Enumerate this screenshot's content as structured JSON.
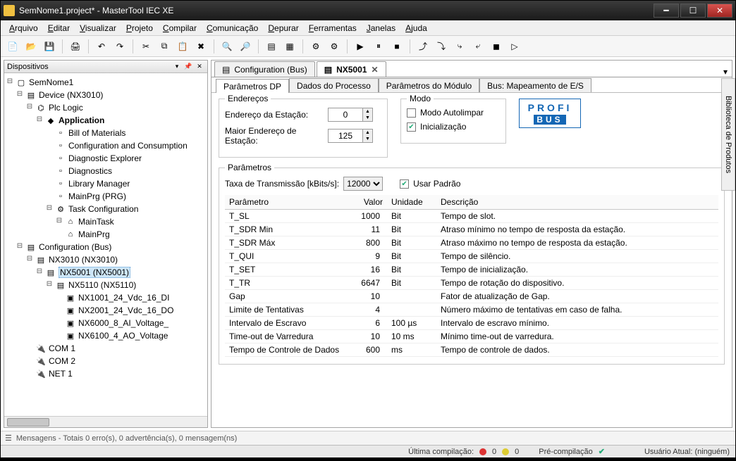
{
  "window": {
    "title": "SemNome1.project* - MasterTool IEC XE"
  },
  "menu": [
    "Arquivo",
    "Editar",
    "Visualizar",
    "Projeto",
    "Compilar",
    "Comunicação",
    "Depurar",
    "Ferramentas",
    "Janelas",
    "Ajuda"
  ],
  "toolbar_icons": [
    "new",
    "open",
    "save",
    "|",
    "print",
    "|",
    "undo",
    "redo",
    "|",
    "cut",
    "copy",
    "paste",
    "delete",
    "|",
    "find",
    "replace",
    "|",
    "props",
    "refs",
    "|",
    "gear",
    "gear2",
    "|",
    "play",
    "pause",
    "stop",
    "|",
    "step-over",
    "step-into",
    "step-out",
    "step-return",
    "stop2",
    "next"
  ],
  "devices_panel": {
    "title": "Dispositivos",
    "root": "SemNome1",
    "device": "Device (NX3010)",
    "plc": "Plc Logic",
    "app": "Application",
    "app_children": [
      "Bill of Materials",
      "Configuration and Consumption",
      "Diagnostic Explorer",
      "Diagnostics",
      "Library Manager",
      "MainPrg (PRG)",
      "Task Configuration"
    ],
    "task_children": [
      "MainTask",
      "MainPrg"
    ],
    "config_bus": "Configuration (Bus)",
    "nx3010": "NX3010 (NX3010)",
    "nx5001": "NX5001 (NX5001)",
    "nx5110": "NX5110 (NX5110)",
    "io_children": [
      "NX1001_24_Vdc_16_DI",
      "NX2001_24_Vdc_16_DO",
      "NX6000_8_AI_Voltage_",
      "NX6100_4_AO_Voltage"
    ],
    "coms": [
      "COM 1",
      "COM 2",
      "NET 1"
    ]
  },
  "doc_tabs": [
    {
      "label": "Configuration (Bus)",
      "active": false
    },
    {
      "label": "NX5001",
      "active": true
    }
  ],
  "inner_tabs": [
    "Parâmetros DP",
    "Dados do Processo",
    "Parâmetros do Módulo",
    "Bus: Mapeamento de E/S"
  ],
  "dp": {
    "group_enderecos": "Endereços",
    "lbl_endereco": "Endereço da Estação:",
    "val_endereco": "0",
    "lbl_maior": "Maior Endereço de Estação:",
    "val_maior": "125",
    "group_modo": "Modo",
    "chk_autolimpar": "Modo Autolimpar",
    "chk_init": "Inicialização",
    "group_param": "Parâmetros",
    "lbl_taxa": "Taxa de Transmissão [kBits/s]:",
    "val_taxa": "12000",
    "chk_padrao": "Usar Padrão",
    "logo_l1": "PROFI",
    "logo_l2": "BUS",
    "th_param": "Parâmetro",
    "th_valor": "Valor",
    "th_unidade": "Unidade",
    "th_desc": "Descrição",
    "rows": [
      {
        "p": "T_SL",
        "v": "1000",
        "u": "Bit",
        "d": "Tempo de slot."
      },
      {
        "p": "T_SDR Min",
        "v": "11",
        "u": "Bit",
        "d": "Atraso mínimo no tempo de resposta da estação."
      },
      {
        "p": "T_SDR Máx",
        "v": "800",
        "u": "Bit",
        "d": "Atraso máximo no tempo de resposta da estação."
      },
      {
        "p": "T_QUI",
        "v": "9",
        "u": "Bit",
        "d": "Tempo de silêncio."
      },
      {
        "p": "T_SET",
        "v": "16",
        "u": "Bit",
        "d": "Tempo de inicialização."
      },
      {
        "p": "T_TR",
        "v": "6647",
        "u": "Bit",
        "d": "Tempo de rotação do dispositivo."
      },
      {
        "p": "Gap",
        "v": "10",
        "u": "",
        "d": "Fator de atualização de Gap."
      },
      {
        "p": "Limite de Tentativas",
        "v": "4",
        "u": "",
        "d": "Número máximo de tentativas em caso de falha."
      },
      {
        "p": "Intervalo de Escravo",
        "v": "6",
        "u": "100 µs",
        "d": "Intervalo de escravo mínimo."
      },
      {
        "p": "Time-out de Varredura",
        "v": "10",
        "u": "10 ms",
        "d": "Mínimo time-out de varredura."
      },
      {
        "p": "Tempo de Controle de Dados",
        "v": "600",
        "u": "ms",
        "d": "Tempo de controle de dados."
      }
    ]
  },
  "side_panel_label": "Biblioteca de Produtos",
  "messages_bar": "Mensagens - Totais 0 erro(s), 0 advertência(s), 0 mensagem(ns)",
  "status": {
    "last_build": "Última compilação:",
    "err": "0",
    "warn": "0",
    "precomp": "Pré-compilação",
    "user": "Usuário Atual: (ninguém)"
  }
}
